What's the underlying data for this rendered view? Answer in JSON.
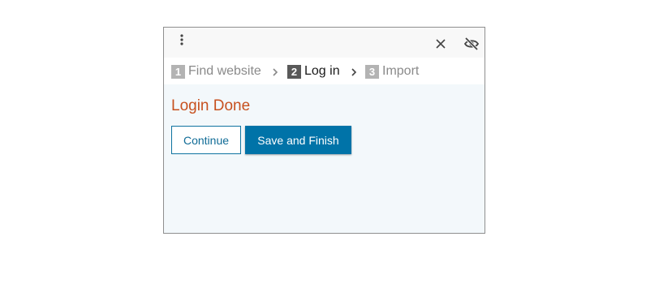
{
  "toolbar": {
    "menu_icon": "vertical-dots-icon",
    "close_icon": "close-icon",
    "hide_icon": "eye-slash-icon"
  },
  "steps": [
    {
      "number": "1",
      "label": "Find website",
      "active": false
    },
    {
      "number": "2",
      "label": "Log in",
      "active": true
    },
    {
      "number": "3",
      "label": "Import",
      "active": false
    }
  ],
  "main": {
    "title": "Login Done",
    "continue_label": "Continue",
    "save_label": "Save and Finish"
  },
  "colors": {
    "title": "#c7511f",
    "primary_button": "#0073a8",
    "panel_background": "#f3f8fb",
    "active_step_badge": "#595959",
    "inactive_step_badge": "#b3b3b3"
  }
}
